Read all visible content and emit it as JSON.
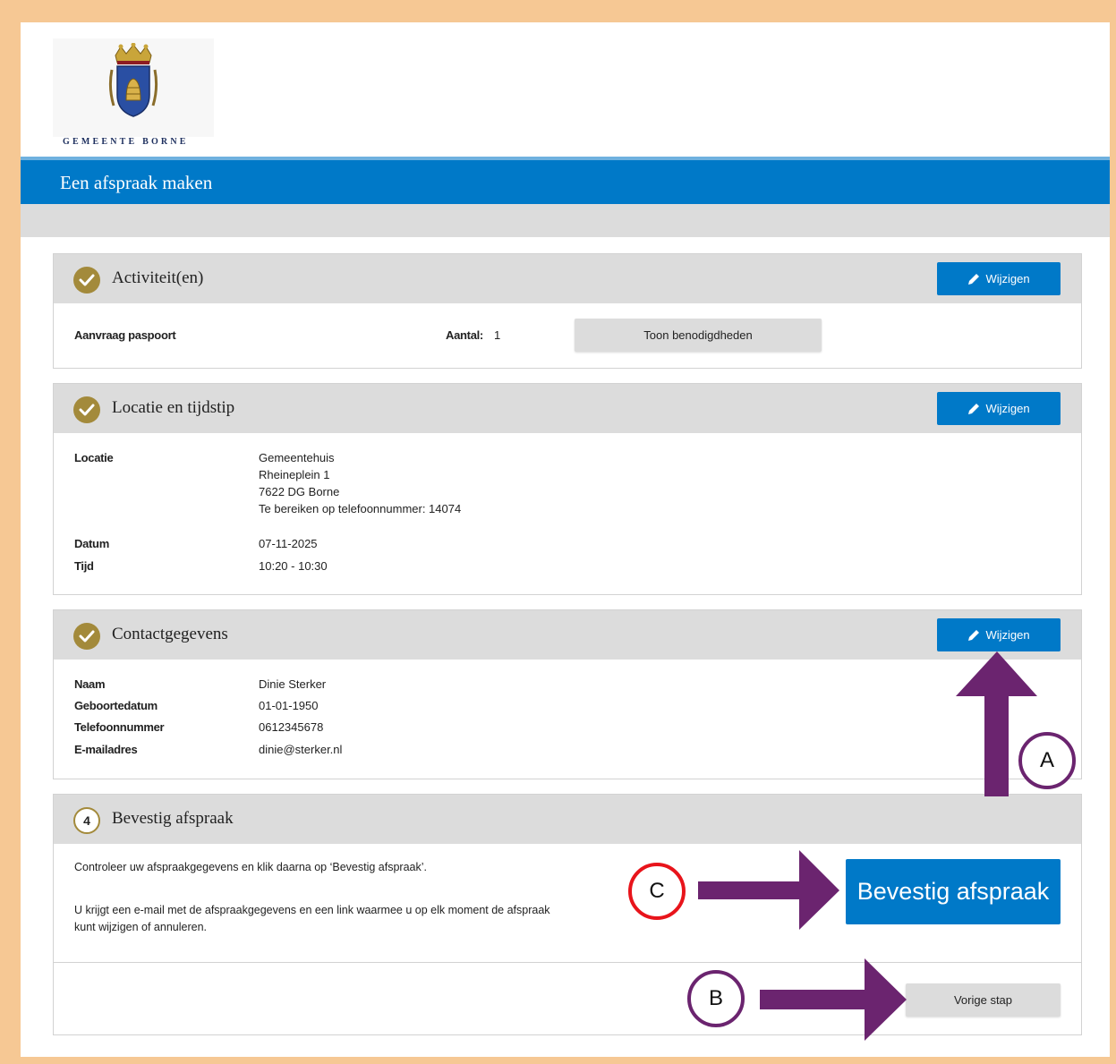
{
  "header": {
    "logo_text": "GEMEENTE BORNE",
    "title": "Een afspraak maken"
  },
  "activities": {
    "title": "Activiteit(en)",
    "edit_label": "Wijzigen",
    "item_label": "Aanvraag paspoort",
    "count_label": "Aantal:",
    "count_value": "1",
    "requirements_button": "Toon benodigdheden"
  },
  "location": {
    "title": "Locatie en tijdstip",
    "edit_label": "Wijzigen",
    "location_label": "Locatie",
    "location_lines": [
      "Gemeentehuis",
      "Rheineplein 1",
      "7622 DG Borne",
      "Te bereiken op telefoonnummer: 14074"
    ],
    "date_label": "Datum",
    "date_value": "07-11-2025",
    "time_label": "Tijd",
    "time_value": "10:20 - 10:30"
  },
  "contact": {
    "title": "Contactgegevens",
    "edit_label": "Wijzigen",
    "fields": [
      {
        "label": "Naam",
        "value": "Dinie Sterker"
      },
      {
        "label": "Geboortedatum",
        "value": "01-01-1950"
      },
      {
        "label": "Telefoonnummer",
        "value": "0612345678"
      },
      {
        "label": "E-mailadres",
        "value": "dinie@sterker.nl"
      }
    ]
  },
  "confirm": {
    "step_number": "4",
    "title": "Bevestig afspraak",
    "instruction": "Controleer uw afspraakgegevens en klik daarna op ‘Bevestig afspraak’.",
    "info_line1": "U krijgt een e-mail met de afspraakgegevens en een link waarmee u op elk moment de afspraak",
    "info_line2": "kunt wijzigen of annuleren.",
    "confirm_button": "Bevestig afspraak",
    "previous_button": "Vorige stap"
  },
  "annotations": {
    "a": "A",
    "b": "B",
    "c": "C",
    "arrow_color": "#6b246f",
    "circle_c_color": "#e8141b"
  },
  "colors": {
    "primary": "#0079c8",
    "check_gold": "#a38a3b",
    "frame": "#f6c894"
  }
}
